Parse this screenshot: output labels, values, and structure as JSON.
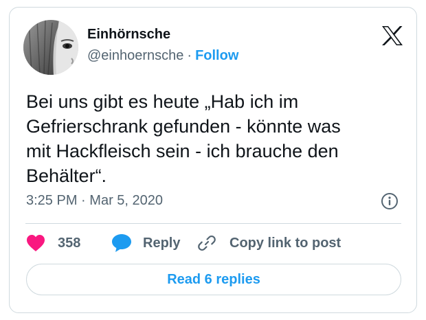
{
  "author": {
    "display_name": "Einhörnsche",
    "handle": "@einhoernsche",
    "separator": "·",
    "follow_label": "Follow"
  },
  "tweet": {
    "text": "Bei uns gibt es heute „Hab ich im\nGefrierschrank gefunden - könnte was\nmit Hackfleisch sein - ich brauche den\nBehälter“.",
    "time": "3:25 PM",
    "separator": "·",
    "date": "Mar 5, 2020"
  },
  "actions": {
    "like_count": "358",
    "reply_label": "Reply",
    "copy_link_label": "Copy link to post"
  },
  "read_replies_label": "Read 6 replies",
  "icons": {
    "brand": "x-logo-icon",
    "like": "heart-icon",
    "reply": "speech-bubble-icon",
    "copy": "link-icon",
    "info": "info-icon"
  },
  "colors": {
    "accent": "#1d9bf0",
    "like": "#f91880",
    "text": "#0f1419",
    "secondary": "#536471",
    "border": "#cfd9de"
  }
}
